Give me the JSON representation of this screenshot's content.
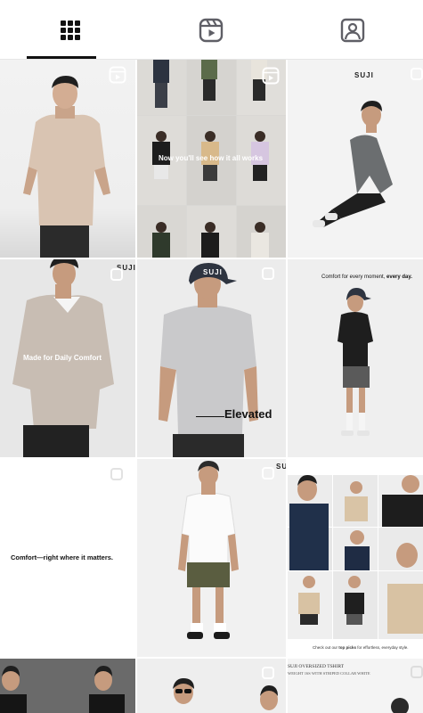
{
  "tabs": [
    {
      "label": "posts",
      "icon": "grid-icon",
      "active": true
    },
    {
      "label": "reels",
      "icon": "reels-icon",
      "active": false
    },
    {
      "label": "tagged",
      "icon": "tagged-icon",
      "active": false
    }
  ],
  "posts": {
    "brand": "SUJI",
    "p2_caption": "Now you'll see how it all works",
    "p4_caption": "Made for Daily Comfort",
    "p5_caption": "Elevated",
    "p6_caption_a": "Comfort for every moment,",
    "p6_caption_b": " every day.",
    "p7_caption": "Comfort—right where it matters.",
    "p9_caption_a": "Check out our ",
    "p9_caption_b": "top picks",
    "p9_caption_c": " for effortless, everyday style.",
    "p11_line1": "SUJI OVERSIZED TSHIRT",
    "p11_line2": "WEIGHT 16S  WITH STRIPED COLLAR WHITE"
  }
}
